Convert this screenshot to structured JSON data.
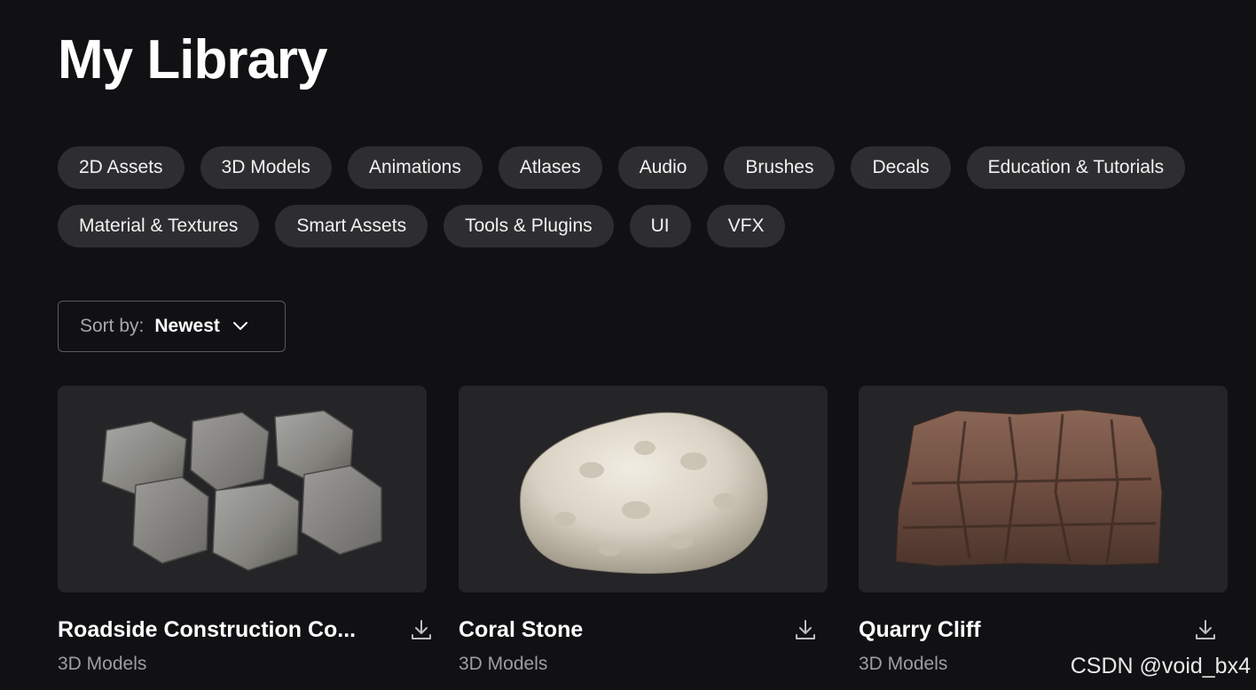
{
  "page": {
    "title": "My Library"
  },
  "filters": {
    "row1": [
      "2D Assets",
      "3D Models",
      "Animations",
      "Atlases",
      "Audio",
      "Brushes",
      "Decals",
      "Education & Tutorials"
    ],
    "row2": [
      "Material & Textures",
      "Smart Assets",
      "Tools & Plugins",
      "UI",
      "VFX"
    ]
  },
  "sort": {
    "label": "Sort by:",
    "value": "Newest",
    "icon": "chevron-down-icon"
  },
  "assets": [
    {
      "title": "Roadside Construction Co...",
      "category": "3D Models",
      "icon": "download-icon"
    },
    {
      "title": "Coral Stone",
      "category": "3D Models",
      "icon": "download-icon"
    },
    {
      "title": "Quarry Cliff",
      "category": "3D Models",
      "icon": "download-icon"
    }
  ],
  "watermark": "CSDN @void_bx4",
  "colors": {
    "background": "#111114",
    "chip": "#2e2e31",
    "card": "#252528",
    "muted_text": "#9d9da2"
  }
}
